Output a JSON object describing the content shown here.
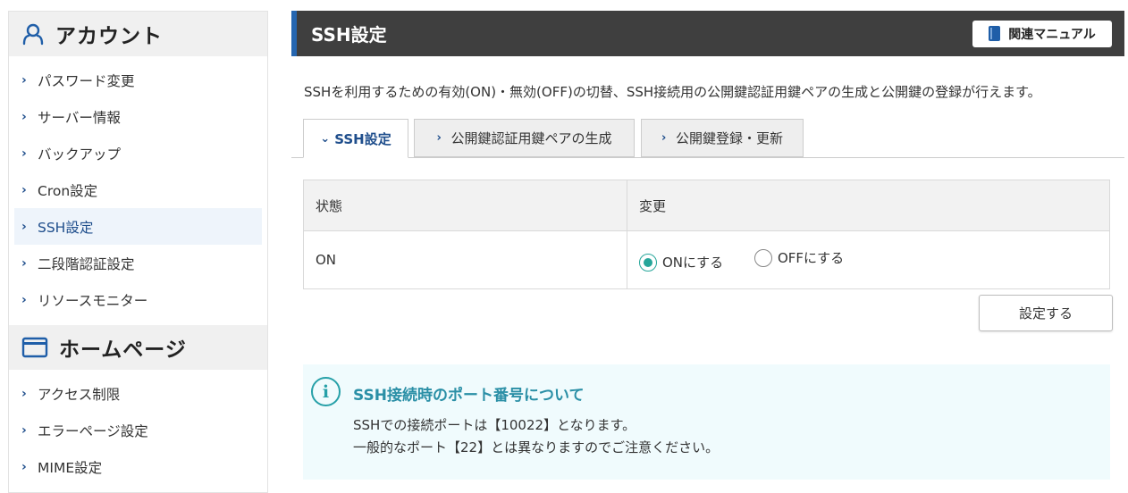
{
  "sidebar": {
    "section1": {
      "title": "アカウント",
      "icon": "user-icon"
    },
    "items1": [
      {
        "label": "パスワード変更"
      },
      {
        "label": "サーバー情報"
      },
      {
        "label": "バックアップ"
      },
      {
        "label": "Cron設定"
      },
      {
        "label": "SSH設定",
        "active": true
      },
      {
        "label": "二段階認証設定"
      },
      {
        "label": "リソースモニター"
      }
    ],
    "section2": {
      "title": "ホームページ",
      "icon": "window-icon"
    },
    "items2": [
      {
        "label": "アクセス制限"
      },
      {
        "label": "エラーページ設定"
      },
      {
        "label": "MIME設定"
      }
    ]
  },
  "header": {
    "title": "SSH設定",
    "manual_label": "関連マニュアル"
  },
  "description": "SSHを利用するための有効(ON)・無効(OFF)の切替、SSH接続用の公開鍵認証用鍵ペアの生成と公開鍵の登録が行えます。",
  "tabs": [
    {
      "label": "SSH設定",
      "active": true
    },
    {
      "label": "公開鍵認証用鍵ペアの生成"
    },
    {
      "label": "公開鍵登録・更新"
    }
  ],
  "table": {
    "headers": [
      "状態",
      "変更"
    ],
    "status_value": "ON",
    "options": [
      {
        "label": "ONにする",
        "checked": true
      },
      {
        "label": "OFFにする",
        "checked": false
      }
    ]
  },
  "submit_label": "設定する",
  "info": {
    "title": "SSH接続時のポート番号について",
    "line1": "SSHでの接続ポートは【10022】となります。",
    "line2": "一般的なポート【22】とは異なりますのでご注意ください。"
  },
  "colors": {
    "accent": "#2566b0",
    "header_bg": "#3f3f3f",
    "radio": "#26a69a",
    "info_title": "#2a8fa6",
    "info_bg": "#f0fbfd"
  }
}
